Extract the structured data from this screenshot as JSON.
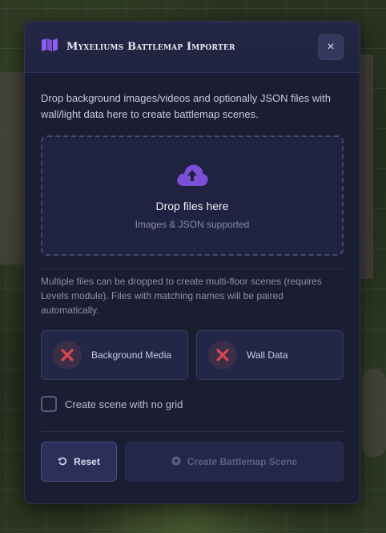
{
  "dialog": {
    "title": "Myxeliums Battlemap Importer",
    "title_icon": "map-icon",
    "close_label": "×"
  },
  "intro_text": "Drop background images/videos and optionally JSON files with wall/light data here to create battlemap scenes.",
  "dropzone": {
    "icon": "cloud-upload-icon",
    "title": "Drop files here",
    "subtitle": "Images & JSON supported"
  },
  "hint_text": "Multiple files can be dropped to create multi-floor scenes (requires Levels module). Files with matching names will be paired automatically.",
  "status": [
    {
      "label": "Background Media",
      "icon": "x-mark-icon",
      "state": "missing"
    },
    {
      "label": "Wall Data",
      "icon": "x-mark-icon",
      "state": "missing"
    }
  ],
  "options": {
    "no_grid_label": "Create scene with no grid",
    "no_grid_checked": false
  },
  "buttons": {
    "reset_label": "Reset",
    "reset_icon": "undo-icon",
    "create_label": "Create Battlemap Scene",
    "create_icon": "plus-circle-icon",
    "create_disabled": true
  },
  "colors": {
    "accent": "#7b4fd6",
    "error": "#e0474c",
    "dialog_bg": "#1b1d33"
  }
}
